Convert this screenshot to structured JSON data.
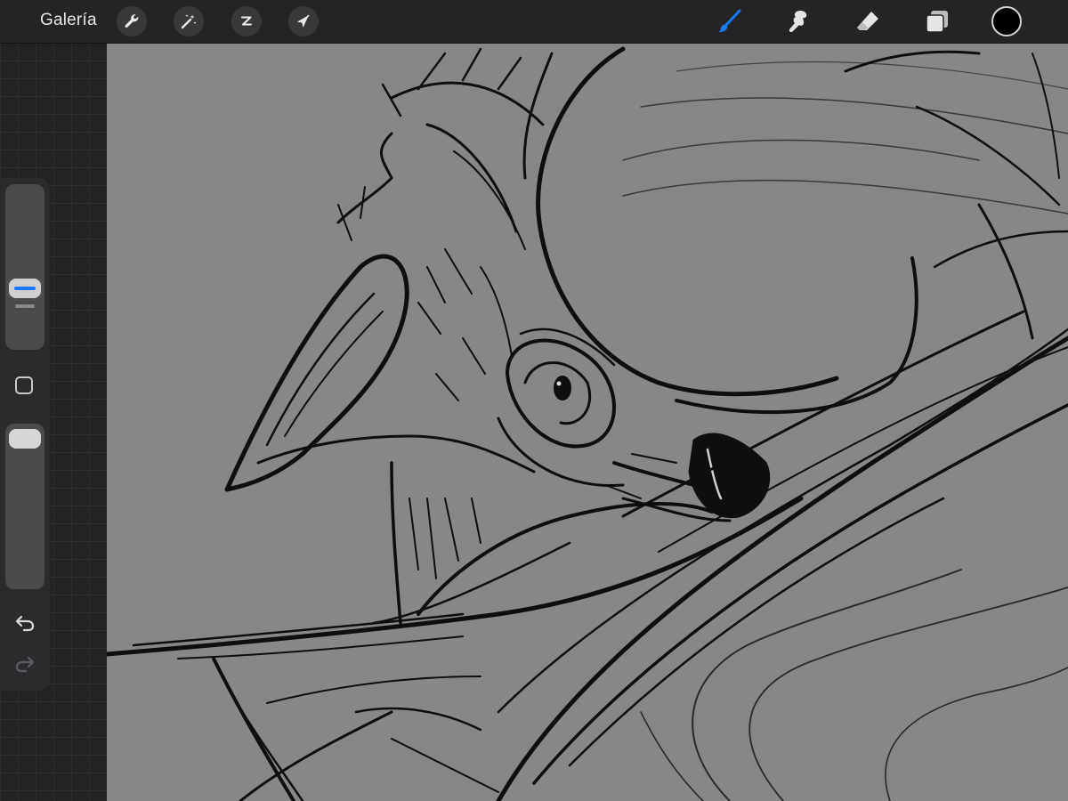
{
  "topbar": {
    "gallery_label": "Galería",
    "actions": [
      {
        "icon": "wrench-icon",
        "name": "actions"
      },
      {
        "icon": "magic-wand-icon",
        "name": "adjustments"
      },
      {
        "icon": "selection-s-icon",
        "name": "selection"
      },
      {
        "icon": "arrow-cursor-icon",
        "name": "transform"
      }
    ],
    "tools": [
      {
        "icon": "brush-icon",
        "name": "paint",
        "active": true
      },
      {
        "icon": "smudge-icon",
        "name": "smudge",
        "active": false
      },
      {
        "icon": "eraser-icon",
        "name": "eraser",
        "active": false
      },
      {
        "icon": "layers-icon",
        "name": "layers",
        "active": false
      }
    ],
    "current_color": "#000000"
  },
  "colors": {
    "accent": "#1778f2",
    "toolbar": "#242426",
    "canvas": "#878787",
    "stroke": "#0d0d0d"
  },
  "sidebar": {
    "brush_size_slider": {
      "icon": "size-slider"
    },
    "modify_button": {
      "icon": "square-outline-icon"
    },
    "opacity_slider": {
      "icon": "opacity-slider"
    },
    "undo": {
      "icon": "undo-arrow-icon"
    },
    "redo": {
      "icon": "redo-arrow-icon",
      "enabled": false
    }
  }
}
